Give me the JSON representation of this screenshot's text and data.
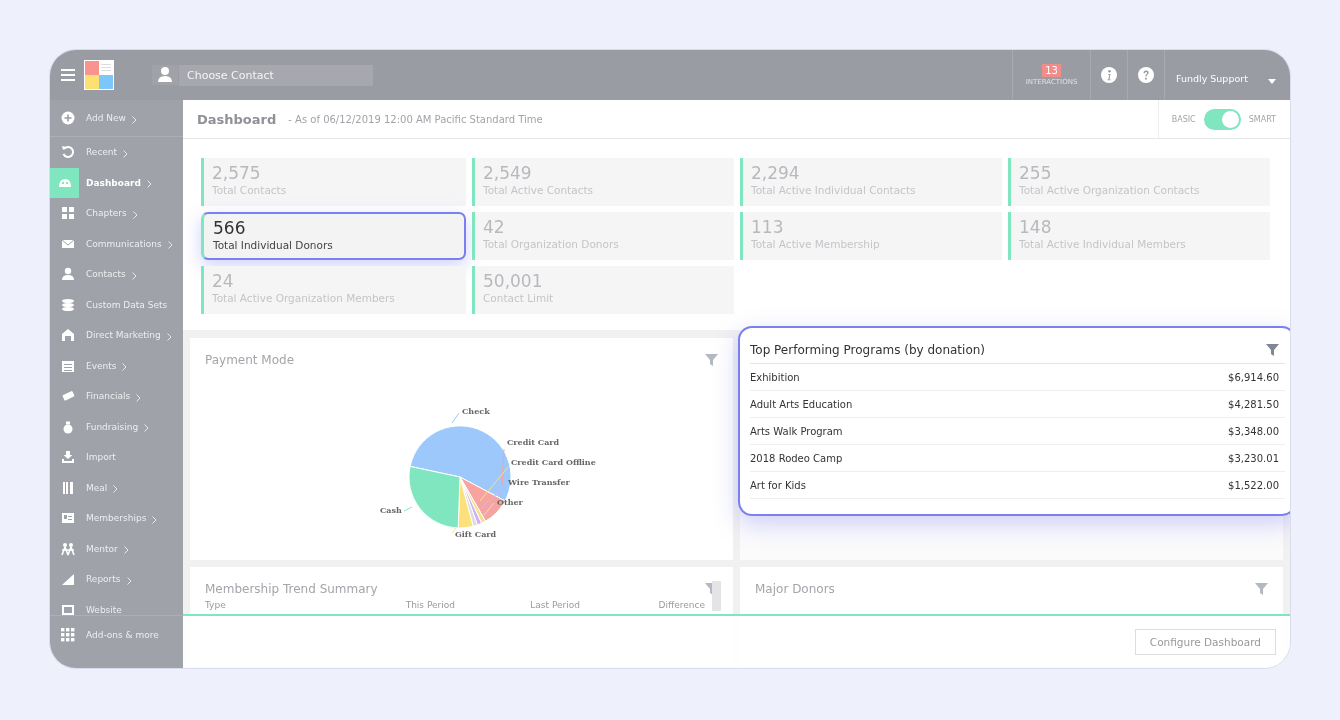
{
  "header": {
    "search": {
      "placeholder": "Choose Contact"
    },
    "interactions": {
      "count": "13",
      "label": "INTERACTIONS"
    },
    "user": "Fundly Support"
  },
  "sidebar": {
    "items": [
      {
        "label": "Add New",
        "arrow": true,
        "selected": false
      },
      {
        "label": "Recent",
        "arrow": true,
        "selected": false
      },
      {
        "label": "Dashboard",
        "arrow": true,
        "selected": true
      },
      {
        "label": "Chapters",
        "arrow": true,
        "selected": false
      },
      {
        "label": "Communications",
        "arrow": true,
        "selected": false
      },
      {
        "label": "Contacts",
        "arrow": true,
        "selected": false
      },
      {
        "label": "Custom Data Sets",
        "arrow": false,
        "selected": false
      },
      {
        "label": "Direct Marketing",
        "arrow": true,
        "selected": false
      },
      {
        "label": "Events",
        "arrow": true,
        "selected": false
      },
      {
        "label": "Financials",
        "arrow": true,
        "selected": false
      },
      {
        "label": "Fundraising",
        "arrow": true,
        "selected": false
      },
      {
        "label": "Import",
        "arrow": false,
        "selected": false
      },
      {
        "label": "Meal",
        "arrow": true,
        "selected": false
      },
      {
        "label": "Memberships",
        "arrow": true,
        "selected": false
      },
      {
        "label": "Mentor",
        "arrow": true,
        "selected": false
      },
      {
        "label": "Reports",
        "arrow": true,
        "selected": false
      },
      {
        "label": "Website",
        "arrow": false,
        "selected": false
      }
    ],
    "footer": "Add-ons & more"
  },
  "page": {
    "title": "Dashboard",
    "subtitle": "- As of 06/12/2019 12:00 AM Pacific Standard Time",
    "mode": {
      "left": "BASIC",
      "right": "SMART",
      "on": true
    }
  },
  "stats": [
    {
      "value": "2,575",
      "label": "Total Contacts",
      "highlighted": false
    },
    {
      "value": "2,549",
      "label": "Total Active Contacts",
      "highlighted": false
    },
    {
      "value": "2,294",
      "label": "Total Active Individual Contacts",
      "highlighted": false
    },
    {
      "value": "255",
      "label": "Total Active Organization Contacts",
      "highlighted": false
    },
    {
      "value": "566",
      "label": "Total Individual Donors",
      "highlighted": true
    },
    {
      "value": "42",
      "label": "Total Organization Donors",
      "highlighted": false
    },
    {
      "value": "113",
      "label": "Total Active Membership",
      "highlighted": false
    },
    {
      "value": "148",
      "label": "Total Active Individual Members",
      "highlighted": false
    },
    {
      "value": "24",
      "label": "Total Active Organization Members",
      "highlighted": false
    },
    {
      "value": "50,001",
      "label": "Contact Limit",
      "highlighted": false
    }
  ],
  "payment_mode": {
    "title": "Payment Mode",
    "slices": [
      {
        "label": "Check",
        "color": "#9dc8fb"
      },
      {
        "label": "Credit Card",
        "color": "#f7a3a0"
      },
      {
        "label": "Credit Card Offline",
        "color": "#f6e08a"
      },
      {
        "label": "Wire Transfer",
        "color": "#d2b0f7"
      },
      {
        "label": "Other",
        "color": "#dcdcdc"
      },
      {
        "label": "Gift Card",
        "color": "#fbe07c"
      },
      {
        "label": "Cash",
        "color": "#7fe6c0"
      }
    ]
  },
  "top_programs": {
    "title": "Top Performing Programs (by donation)",
    "rows": [
      {
        "name": "Exhibition",
        "amount": "$6,914.60"
      },
      {
        "name": "Adult Arts Education",
        "amount": "$4,281.50"
      },
      {
        "name": "Arts Walk Program",
        "amount": "$3,348.00"
      },
      {
        "name": "2018 Rodeo Camp",
        "amount": "$3,230.01"
      },
      {
        "name": "Art for Kids",
        "amount": "$1,522.00"
      }
    ]
  },
  "membership_trend": {
    "title": "Membership Trend Summary",
    "columns": [
      "Type",
      "This Period",
      "Last Period",
      "Difference"
    ]
  },
  "major_donors": {
    "title": "Major Donors"
  },
  "footer": {
    "button": "Configure Dashboard"
  }
}
